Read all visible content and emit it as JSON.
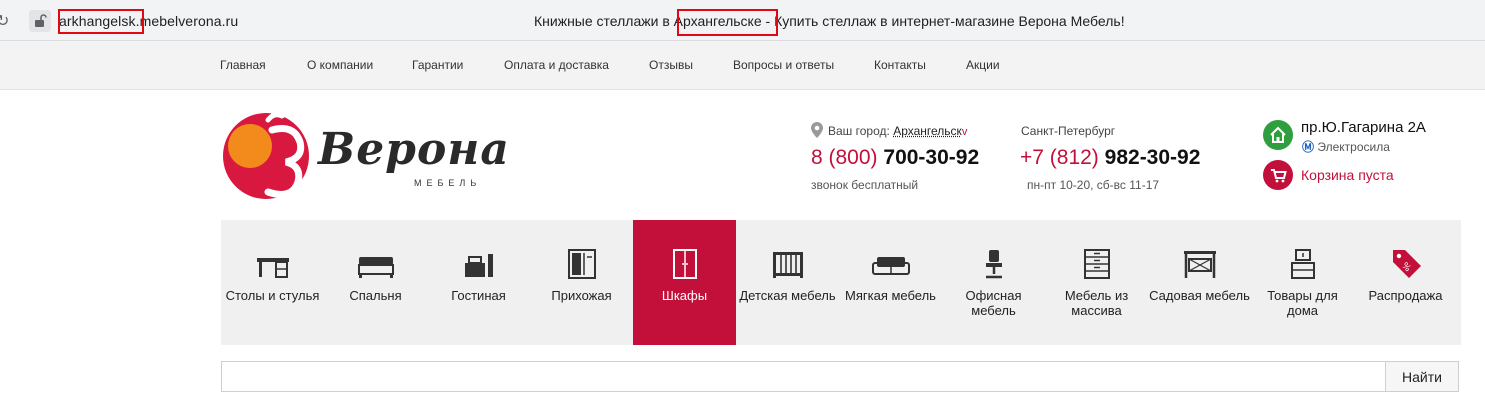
{
  "browser": {
    "url_host": "arkhangelsk.mebelverona.ru",
    "tab_title": "Книжные стеллажи в Архангельске - Купить стеллаж в интернет-магазине Верона Мебель!"
  },
  "topnav": {
    "items": [
      "Главная",
      "О компании",
      "Гарантии",
      "Оплата и доставка",
      "Отзывы",
      "Вопросы и ответы",
      "Контакты",
      "Акции"
    ]
  },
  "logo": {
    "name": "Верона",
    "sub": "МЕБЕЛЬ"
  },
  "city": {
    "label": "Ваш город:",
    "value": "Архангельск",
    "arrow": "v"
  },
  "phone_free": {
    "code": "8 (800)",
    "number": "700-30-92",
    "note": "звонок бесплатный"
  },
  "phone_spb": {
    "city": "Санкт-Петербург",
    "code": "+7 (812)",
    "number": "982-30-92",
    "hours": "пн-пт 10-20, сб-вс 11-17"
  },
  "address": {
    "street": "пр.Ю.Гагарина 2А",
    "metro": "Электросила"
  },
  "cart": {
    "text": "Корзина пуста"
  },
  "categories": [
    {
      "label": "Столы и стулья",
      "icon": "desk-icon"
    },
    {
      "label": "Спальня",
      "icon": "bed-icon"
    },
    {
      "label": "Гостиная",
      "icon": "tv-stand-icon"
    },
    {
      "label": "Прихожая",
      "icon": "hallway-icon"
    },
    {
      "label": "Шкафы",
      "icon": "wardrobe-icon",
      "active": true
    },
    {
      "label": "Детская мебель",
      "icon": "crib-icon"
    },
    {
      "label": "Мягкая мебель",
      "icon": "sofa-icon"
    },
    {
      "label": "Офисная мебель",
      "icon": "office-chair-icon"
    },
    {
      "label": "Мебель из массива",
      "icon": "dresser-icon"
    },
    {
      "label": "Садовая мебель",
      "icon": "garden-swing-icon"
    },
    {
      "label": "Товары для дома",
      "icon": "home-goods-icon"
    },
    {
      "label": "Распродажа",
      "icon": "sale-tag-icon"
    }
  ],
  "search": {
    "placeholder": "",
    "button": "Найти"
  },
  "colors": {
    "accent": "#c2103a",
    "green": "#2e9e3e",
    "highlight": "#e30613"
  }
}
